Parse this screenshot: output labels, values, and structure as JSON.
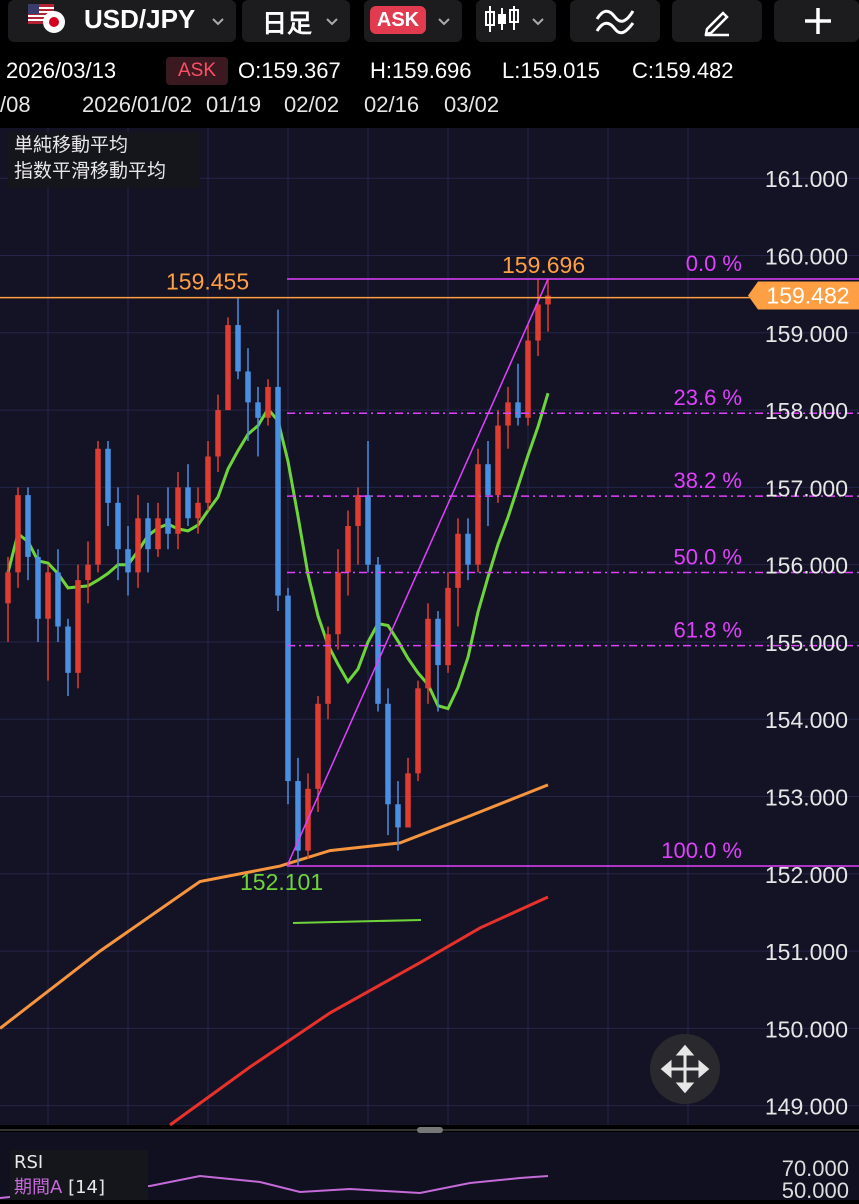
{
  "toolbar": {
    "pair": "USD/JPY",
    "timeframe": "日足",
    "price_type": "ASK",
    "icons": [
      "us-jp-flag-icon",
      "chevron-down-icon",
      "candlestick-icon",
      "indicator-icon",
      "pen-icon",
      "plus-icon"
    ]
  },
  "info": {
    "date": "2026/03/13",
    "side": "ASK",
    "open": "O:159.367",
    "high": "H:159.696",
    "low": "L:159.015",
    "close": "C:159.482"
  },
  "dates": {
    "d0": "/08",
    "d1": "2026/01/02",
    "d2": "01/19",
    "d3": "02/02",
    "d4": "02/16",
    "d5": "03/02"
  },
  "indicators": {
    "sma": "単純移動平均",
    "ema": "指数平滑移動平均"
  },
  "rsi": {
    "label": "RSI",
    "period": "期間A",
    "period_value": "[14]",
    "level_70": "70.000",
    "level_50": "50.000"
  },
  "colors": {
    "bull": "#e03c31",
    "bear": "#4a90e2",
    "fib": "#e040fb",
    "price_line": "#ff9f43",
    "ma_green": "#6fd43a",
    "ma_orange": "#f7953f",
    "ma_red": "#e8312a"
  },
  "chart_data": {
    "type": "candlestick",
    "y_axis_ticks": [
      "161.000",
      "160.000",
      "159.000",
      "158.000",
      "157.000",
      "156.000",
      "155.000",
      "154.000",
      "153.000",
      "152.000",
      "151.000",
      "150.000",
      "149.000"
    ],
    "ylim": [
      148.75,
      161.65
    ],
    "current_price": "159.482",
    "high_label": "159.696",
    "prev_high_label": "159.455",
    "low_label": "152.101",
    "fibonacci": [
      {
        "level": "0.0 %",
        "price": 159.696
      },
      {
        "level": "23.6 %",
        "price": 157.96
      },
      {
        "level": "38.2 %",
        "price": 156.887
      },
      {
        "level": "50.0 %",
        "price": 155.899
      },
      {
        "level": "61.8 %",
        "price": 154.952
      },
      {
        "level": "100.0 %",
        "price": 152.101
      }
    ],
    "candles": [
      {
        "o": 155.5,
        "h": 156.1,
        "l": 155.0,
        "c": 155.9
      },
      {
        "o": 155.9,
        "h": 157.0,
        "l": 155.7,
        "c": 156.9
      },
      {
        "o": 156.9,
        "h": 157.0,
        "l": 155.8,
        "c": 156.1
      },
      {
        "o": 156.1,
        "h": 156.2,
        "l": 155.0,
        "c": 155.3
      },
      {
        "o": 155.3,
        "h": 156.0,
        "l": 154.5,
        "c": 155.9
      },
      {
        "o": 155.9,
        "h": 156.2,
        "l": 155.0,
        "c": 155.2
      },
      {
        "o": 155.2,
        "h": 155.3,
        "l": 154.3,
        "c": 154.6
      },
      {
        "o": 154.6,
        "h": 156.0,
        "l": 154.4,
        "c": 155.8
      },
      {
        "o": 155.8,
        "h": 156.3,
        "l": 155.5,
        "c": 156.0
      },
      {
        "o": 156.0,
        "h": 157.6,
        "l": 155.9,
        "c": 157.5
      },
      {
        "o": 157.5,
        "h": 157.6,
        "l": 156.5,
        "c": 156.8
      },
      {
        "o": 156.8,
        "h": 157.0,
        "l": 155.8,
        "c": 156.2
      },
      {
        "o": 156.2,
        "h": 156.5,
        "l": 155.6,
        "c": 155.9
      },
      {
        "o": 155.9,
        "h": 156.9,
        "l": 155.7,
        "c": 156.6
      },
      {
        "o": 156.6,
        "h": 156.8,
        "l": 155.9,
        "c": 156.2
      },
      {
        "o": 156.2,
        "h": 156.8,
        "l": 156.1,
        "c": 156.6
      },
      {
        "o": 156.6,
        "h": 157.0,
        "l": 156.2,
        "c": 156.4
      },
      {
        "o": 156.4,
        "h": 157.2,
        "l": 156.2,
        "c": 157.0
      },
      {
        "o": 157.0,
        "h": 157.3,
        "l": 156.5,
        "c": 156.6
      },
      {
        "o": 156.6,
        "h": 157.0,
        "l": 156.4,
        "c": 156.8
      },
      {
        "o": 156.8,
        "h": 157.6,
        "l": 156.7,
        "c": 157.4
      },
      {
        "o": 157.4,
        "h": 158.2,
        "l": 157.2,
        "c": 158.0
      },
      {
        "o": 158.0,
        "h": 159.2,
        "l": 158.0,
        "c": 159.1
      },
      {
        "o": 159.1,
        "h": 159.455,
        "l": 158.4,
        "c": 158.5
      },
      {
        "o": 158.5,
        "h": 158.8,
        "l": 157.6,
        "c": 158.1
      },
      {
        "o": 158.1,
        "h": 158.3,
        "l": 157.4,
        "c": 157.9
      },
      {
        "o": 157.9,
        "h": 158.4,
        "l": 157.8,
        "c": 158.3
      },
      {
        "o": 158.3,
        "h": 159.3,
        "l": 155.4,
        "c": 155.6
      },
      {
        "o": 155.6,
        "h": 155.7,
        "l": 152.9,
        "c": 153.2
      },
      {
        "o": 153.2,
        "h": 153.5,
        "l": 152.101,
        "c": 152.3
      },
      {
        "o": 152.3,
        "h": 153.3,
        "l": 152.2,
        "c": 153.1
      },
      {
        "o": 153.1,
        "h": 154.3,
        "l": 152.8,
        "c": 154.2
      },
      {
        "o": 154.2,
        "h": 155.2,
        "l": 154.0,
        "c": 155.1
      },
      {
        "o": 155.1,
        "h": 156.2,
        "l": 154.9,
        "c": 155.9
      },
      {
        "o": 155.9,
        "h": 156.7,
        "l": 155.6,
        "c": 156.5
      },
      {
        "o": 156.5,
        "h": 157.0,
        "l": 156.0,
        "c": 156.9
      },
      {
        "o": 156.9,
        "h": 157.6,
        "l": 155.9,
        "c": 156.0
      },
      {
        "o": 156.0,
        "h": 156.1,
        "l": 154.1,
        "c": 154.2
      },
      {
        "o": 154.2,
        "h": 154.4,
        "l": 152.5,
        "c": 152.9
      },
      {
        "o": 152.9,
        "h": 153.2,
        "l": 152.3,
        "c": 152.6
      },
      {
        "o": 152.6,
        "h": 153.5,
        "l": 152.6,
        "c": 153.3
      },
      {
        "o": 153.3,
        "h": 154.5,
        "l": 153.2,
        "c": 154.4
      },
      {
        "o": 154.4,
        "h": 155.5,
        "l": 154.2,
        "c": 155.3
      },
      {
        "o": 155.3,
        "h": 155.4,
        "l": 154.1,
        "c": 154.7
      },
      {
        "o": 154.7,
        "h": 155.9,
        "l": 154.6,
        "c": 155.7
      },
      {
        "o": 155.7,
        "h": 156.6,
        "l": 155.2,
        "c": 156.4
      },
      {
        "o": 156.4,
        "h": 156.6,
        "l": 155.8,
        "c": 156.0
      },
      {
        "o": 156.0,
        "h": 157.5,
        "l": 155.9,
        "c": 157.3
      },
      {
        "o": 157.3,
        "h": 157.6,
        "l": 156.5,
        "c": 156.9
      },
      {
        "o": 156.9,
        "h": 158.0,
        "l": 156.8,
        "c": 157.8
      },
      {
        "o": 157.8,
        "h": 158.3,
        "l": 157.5,
        "c": 158.1
      },
      {
        "o": 158.1,
        "h": 158.6,
        "l": 157.8,
        "c": 157.9
      },
      {
        "o": 157.9,
        "h": 159.1,
        "l": 157.8,
        "c": 158.9
      },
      {
        "o": 158.9,
        "h": 159.696,
        "l": 158.7,
        "c": 159.367
      },
      {
        "o": 159.367,
        "h": 159.696,
        "l": 159.015,
        "c": 159.482
      }
    ]
  }
}
